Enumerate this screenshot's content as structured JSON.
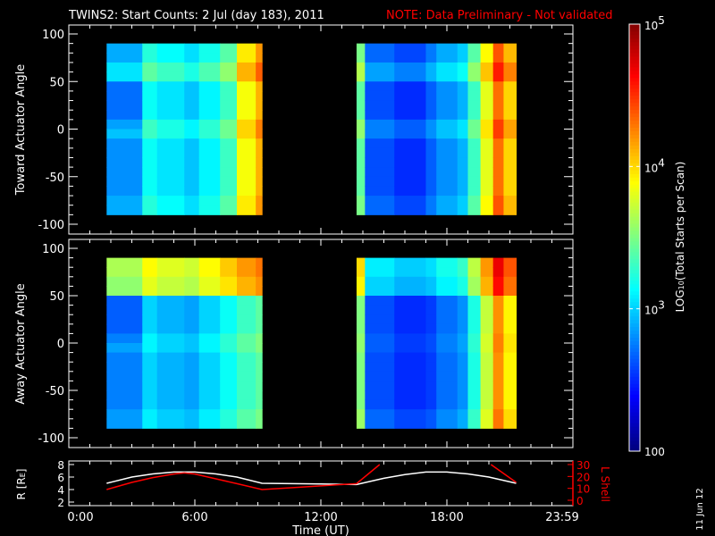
{
  "title": "TWINS2: Start Counts:  2 Jul (day 183), 2011",
  "note": "NOTE: Data Preliminary - Not validated",
  "colors": {
    "note": "#ff0000",
    "r_line": "#ffffff",
    "lshell_line": "#ff0000",
    "axis": "#ffffff"
  },
  "chart_data": [
    {
      "type": "heatmap",
      "name": "toward",
      "ylabel": "Toward Actuator Angle",
      "ylim": [
        -110,
        110
      ],
      "yticks": [
        "100",
        "50",
        "0",
        "-50",
        "-100"
      ],
      "ytick_values": [
        100,
        50,
        0,
        -50,
        -100
      ],
      "angle_range": [
        -90,
        90
      ],
      "x_units": "hours UT",
      "blocks": [
        {
          "start": 1.8,
          "end": 9.2,
          "columns": [
            [
              1.8,
              2.8
            ],
            [
              3.5,
              3.15
            ],
            [
              4.2,
              3.05
            ],
            [
              5.5,
              2.95
            ],
            [
              6.2,
              3.1
            ],
            [
              7.2,
              3.3
            ],
            [
              8.0,
              3.85
            ],
            [
              8.9,
              4.1
            ]
          ]
        },
        {
          "start": 13.7,
          "end": 21.3,
          "columns": [
            [
              13.7,
              3.4
            ],
            [
              14.1,
              2.6
            ],
            [
              15.5,
              2.5
            ],
            [
              17.0,
              2.65
            ],
            [
              17.5,
              2.8
            ],
            [
              18.5,
              2.9
            ],
            [
              19.0,
              3.3
            ],
            [
              19.6,
              3.8
            ],
            [
              20.2,
              4.3
            ],
            [
              20.7,
              4.0
            ]
          ]
        }
      ],
      "bands": [
        {
          "angle_from": 55,
          "angle_to": 66,
          "delta": 0.25
        },
        {
          "angle_from": -3,
          "angle_to": 3,
          "delta": 0.15
        }
      ]
    },
    {
      "type": "heatmap",
      "name": "away",
      "ylabel": "Away Actuator Angle",
      "ylim": [
        -110,
        110
      ],
      "yticks": [
        "100",
        "50",
        "0",
        "-50",
        "-100"
      ],
      "ytick_values": [
        100,
        50,
        0,
        -50,
        -100
      ],
      "angle_range": [
        -90,
        90
      ],
      "x_units": "hours UT",
      "blocks": [
        {
          "start": 1.8,
          "end": 9.2,
          "columns": [
            [
              1.8,
              2.75
            ],
            [
              3.5,
              3.0
            ],
            [
              4.2,
              2.9
            ],
            [
              5.5,
              2.85
            ],
            [
              6.2,
              3.0
            ],
            [
              7.2,
              3.15
            ],
            [
              8.0,
              3.3
            ],
            [
              8.9,
              3.4
            ]
          ]
        },
        {
          "start": 13.7,
          "end": 21.3,
          "columns": [
            [
              13.7,
              3.5
            ],
            [
              14.1,
              2.6
            ],
            [
              15.5,
              2.5
            ],
            [
              17.0,
              2.55
            ],
            [
              17.5,
              2.7
            ],
            [
              18.5,
              2.8
            ],
            [
              19.0,
              3.2
            ],
            [
              19.6,
              3.7
            ],
            [
              20.2,
              4.2
            ],
            [
              20.7,
              3.9
            ]
          ]
        }
      ],
      "bands": [
        {
          "angle_from": 60,
          "angle_to": 80,
          "delta": 0.8
        },
        {
          "angle_from": -3,
          "angle_to": 3,
          "delta": 0.1
        }
      ]
    },
    {
      "type": "line",
      "name": "orbit",
      "xlabel": "Time (UT)",
      "xticks": [
        "0:00",
        "6:00",
        "12:00",
        "18:00",
        "23:59"
      ],
      "xtick_values": [
        0,
        6,
        12,
        18,
        24
      ],
      "xlim": [
        0,
        24
      ],
      "left_axis": {
        "label": "R [R",
        "label_sub": "E",
        "label_end": "]",
        "ylim": [
          2,
          8
        ],
        "ticks": [
          "8",
          "6",
          "4",
          "2"
        ],
        "tick_values": [
          8,
          6,
          4,
          2
        ]
      },
      "right_axis": {
        "label": "L Shell",
        "ylim": [
          0,
          30
        ],
        "ticks": [
          "30",
          "20",
          "10",
          "0"
        ],
        "tick_values": [
          30,
          20,
          10,
          0
        ]
      },
      "series": [
        {
          "name": "R",
          "axis": "left",
          "x": [
            1.8,
            3,
            4,
            5,
            6,
            7,
            8,
            9.2,
            12,
            13.7,
            15,
            16,
            17,
            18,
            19,
            20,
            21.3
          ],
          "y": [
            5.0,
            6.0,
            6.5,
            6.8,
            6.8,
            6.5,
            6.0,
            5.0,
            4.9,
            4.8,
            5.8,
            6.4,
            6.8,
            6.8,
            6.5,
            6.0,
            5.0
          ]
        },
        {
          "name": "L Shell",
          "axis": "right",
          "x": [
            1.8,
            3,
            4,
            5,
            5.5,
            6,
            7,
            8,
            9.2,
            11,
            13.7,
            14.8
          ],
          "y": [
            9,
            15,
            19,
            22,
            23,
            22,
            18,
            14,
            9,
            11,
            14,
            30
          ]
        },
        {
          "name": "L Shell (2)",
          "axis": "right",
          "x": [
            20.1,
            21.3
          ],
          "y": [
            30,
            15
          ]
        }
      ]
    }
  ],
  "colorbar": {
    "label": "LOG",
    "label_sub": "10",
    "label_rest": "(Total Starts per Scan)",
    "range_log": [
      2,
      5
    ],
    "ticks": [
      {
        "base": "10",
        "exp": "5",
        "value": 5
      },
      {
        "base": "10",
        "exp": "4",
        "value": 4
      },
      {
        "base": "10",
        "exp": "3",
        "value": 3
      },
      {
        "base": "100",
        "exp": "",
        "value": 2
      }
    ]
  },
  "date_stamp": "11 Jun 12"
}
